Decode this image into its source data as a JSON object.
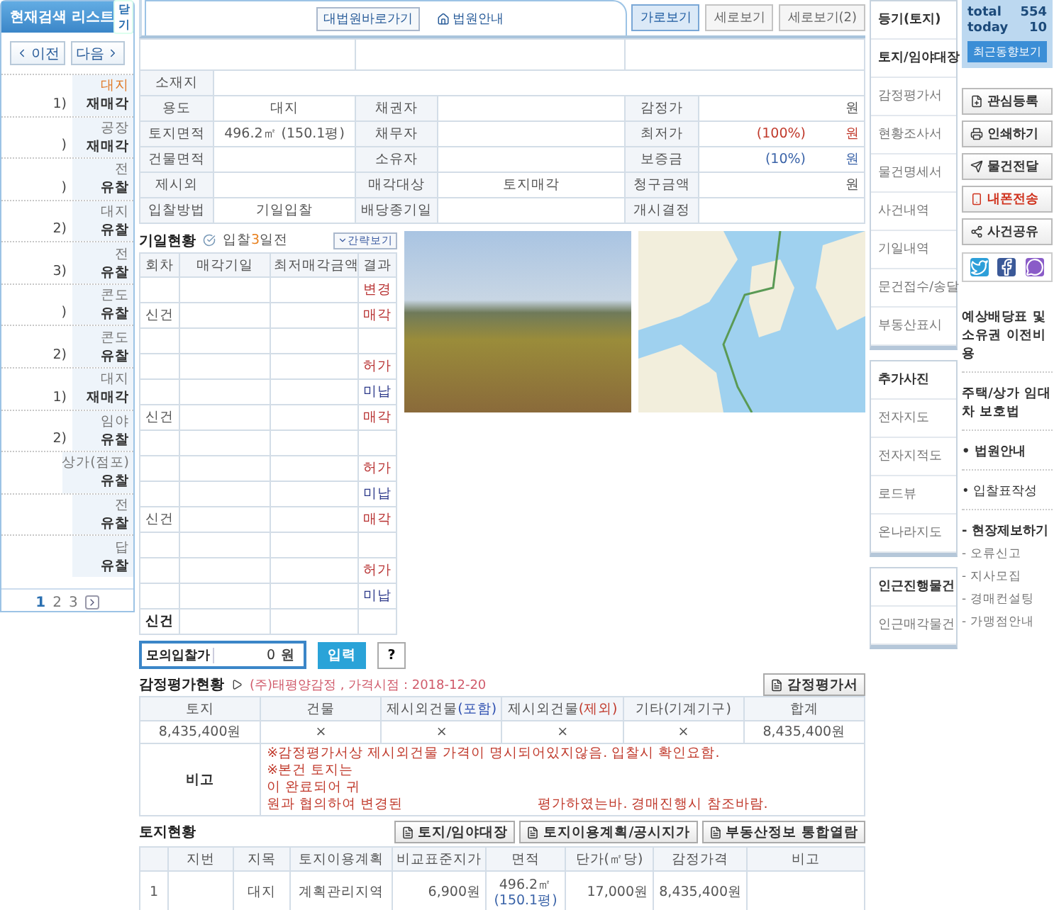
{
  "search_list": {
    "title": "현재검색 리스트",
    "close": "닫기",
    "prev": "이전",
    "next": "다음",
    "items": [
      {
        "number": "1)",
        "type": "대지",
        "status": "재매각",
        "selected": true
      },
      {
        "number": ")",
        "type": "공장",
        "status": "재매각",
        "selected": false
      },
      {
        "number": ")",
        "type": "전",
        "status": "유찰",
        "selected": false
      },
      {
        "number": "2)",
        "type": "대지",
        "status": "유찰",
        "selected": false
      },
      {
        "number": "3)",
        "type": "전",
        "status": "유찰",
        "selected": false
      },
      {
        "number": ")",
        "type": "콘도",
        "status": "유찰",
        "selected": false
      },
      {
        "number": "2)",
        "type": "콘도",
        "status": "유찰",
        "selected": false
      },
      {
        "number": "1)",
        "type": "대지",
        "status": "재매각",
        "selected": false
      },
      {
        "number": "2)",
        "type": "임야",
        "status": "유찰",
        "selected": false
      },
      {
        "type": "상가(점포)",
        "status": "유찰",
        "selected": false
      },
      {
        "type": "전",
        "status": "유찰",
        "selected": false
      },
      {
        "type": "답",
        "status": "유찰",
        "selected": false
      }
    ],
    "pages": [
      {
        "label": "1",
        "selected": true
      },
      {
        "label": "2",
        "selected": false
      },
      {
        "label": "3",
        "selected": false
      }
    ]
  },
  "top_links": [
    {
      "label": "대법원바로가기",
      "kind": "plain"
    },
    {
      "label": "법원안내",
      "kind": "home"
    }
  ],
  "view_buttons": [
    {
      "label": "가로보기",
      "selected": true
    },
    {
      "label": "세로보기",
      "selected": false
    },
    {
      "label": "세로보기(2)",
      "selected": false
    }
  ],
  "info_table": {
    "address_label": "소재지",
    "rows": [
      {
        "label1": "용도",
        "value1": "대지",
        "label2": "채권자",
        "label3": "감정가",
        "unit": "원",
        "color": "#555555"
      },
      {
        "label1": "토지면적",
        "value1": "496.2㎡ (150.1평)",
        "label2": "채무자",
        "label3": "최저가",
        "percent": "(100%)",
        "unit": "원",
        "color": "#c0392b"
      },
      {
        "label1": "건물면적",
        "label2": "소유자",
        "label3": "보증금",
        "percent": "(10%)",
        "unit": "원",
        "color": "#3a63a8"
      },
      {
        "label1": "제시외",
        "label2": "매각대상",
        "value2": "토지매각",
        "label3": "청구금액",
        "unit": "원",
        "color": "#555555"
      },
      {
        "label1": "입찰방법",
        "value1": "기일입찰",
        "label2": "배당종기일",
        "label3": "개시결정"
      }
    ]
  },
  "auction_history": {
    "title": "기일현황",
    "notice_before": "입찰",
    "notice_highlight": "3",
    "notice_after": "일전",
    "toggle": "간략보기",
    "columns": [
      "회차",
      "매각기일",
      "최저매각금액",
      "결과"
    ],
    "rows": [
      {
        "kind": "result",
        "result": "변경",
        "color": "#b83232"
      },
      {
        "kind": "result",
        "round": "신건",
        "result": "매각",
        "color": "#b83232"
      },
      {
        "kind": "blank"
      },
      {
        "kind": "result",
        "result": "허가",
        "color": "#b83232"
      },
      {
        "kind": "result",
        "result": "미납",
        "color": "#2d3a8a"
      },
      {
        "kind": "result",
        "round": "신건",
        "result": "매각",
        "color": "#b83232"
      },
      {
        "kind": "blank"
      },
      {
        "kind": "result",
        "result": "허가",
        "color": "#b83232"
      },
      {
        "kind": "result",
        "result": "미납",
        "color": "#2d3a8a"
      },
      {
        "kind": "result",
        "round": "신건",
        "result": "매각",
        "color": "#b83232"
      },
      {
        "kind": "blank"
      },
      {
        "kind": "result",
        "result": "허가",
        "color": "#b83232"
      },
      {
        "kind": "result",
        "result": "미납",
        "color": "#2d3a8a"
      },
      {
        "kind": "current",
        "round": "신건"
      }
    ]
  },
  "mock_bid": {
    "label": "모의입찰가",
    "value": "0",
    "unit": "원",
    "submit": "입력",
    "help": "?"
  },
  "appraisal": {
    "title": "감정평가현황",
    "source": "(주)태평양감정 , 가격시점 : 2018-12-20",
    "doc_button": "감정평가서",
    "columns": [
      {
        "label": "토지"
      },
      {
        "label": "건물"
      },
      {
        "label": "제시외건물",
        "note": "(포함)",
        "color": "#2d4fb0"
      },
      {
        "label": "제시외건물",
        "note": "(제외)",
        "color": "#c0392b"
      },
      {
        "label": "기타(기계기구)"
      },
      {
        "label": "합계"
      }
    ],
    "values": [
      "8,435,400원",
      "×",
      "×",
      "×",
      "×",
      "8,435,400원"
    ],
    "remark_label": "비고",
    "remarks": [
      [
        "※감정평가서상 제시외건물 가격이 명시되어있지않음. 입찰시 확인요함."
      ],
      [
        "※본건 토지는"
      ],
      [
        "이 완료되어 귀"
      ],
      [
        "원과 협의하여 변경된",
        "평가하였는바. 경매진행시 참조바람."
      ]
    ]
  },
  "land": {
    "title": "토지현황",
    "buttons": [
      "토지/임야대장",
      "토지이용계획/공시지가",
      "부동산정보 통합열람"
    ],
    "columns": [
      "지번",
      "지목",
      "토지이용계획",
      "비교표준지가",
      "면적",
      "단가(㎡당)",
      "감정가격",
      "비고"
    ],
    "rows": [
      {
        "no": "1",
        "category": "대지",
        "plan": "계획관리지역",
        "std_price": "6,900원",
        "area": "496.2㎡",
        "area_pyeong": "(150.1평)",
        "unit_price": "17,000원",
        "appraisal": "8,435,400원"
      }
    ]
  },
  "nav_groups": [
    {
      "items": [
        {
          "label": "등기(토지)",
          "bold": true
        },
        {
          "label": "토지/임야대장",
          "bold": true
        },
        {
          "label": "감정평가서",
          "bold": false
        },
        {
          "label": "현황조사서",
          "bold": false
        },
        {
          "label": "물건명세서",
          "bold": false
        },
        {
          "label": "사건내역",
          "bold": false
        },
        {
          "label": "기일내역",
          "bold": false
        },
        {
          "label": "문건접수/송달",
          "bold": false
        },
        {
          "label": "부동산표시",
          "bold": false
        }
      ]
    },
    {
      "items": [
        {
          "label": "추가사진",
          "bold": true
        },
        {
          "label": "전자지도",
          "bold": false
        },
        {
          "label": "전자지적도",
          "bold": false
        },
        {
          "label": "로드뷰",
          "bold": false
        },
        {
          "label": "온나라지도",
          "bold": false
        }
      ]
    },
    {
      "items": [
        {
          "label": "인근진행물건",
          "bold": true
        },
        {
          "label": "인근매각물건",
          "bold": false
        }
      ]
    }
  ],
  "stats": [
    {
      "label": "total",
      "value": "554"
    },
    {
      "label": "today",
      "value": "10"
    }
  ],
  "recent_button": "최근동향보기",
  "actions": [
    {
      "label": "관심등록",
      "kind": "bookmark",
      "alert": false
    },
    {
      "label": "인쇄하기",
      "kind": "print",
      "alert": false
    },
    {
      "label": "물건전달",
      "kind": "send",
      "alert": false
    },
    {
      "label": "내폰전송",
      "kind": "phone",
      "alert": true
    },
    {
      "label": "사건공유",
      "kind": "share",
      "alert": false
    }
  ],
  "social": [
    {
      "kind": "twitter"
    },
    {
      "kind": "facebook"
    },
    {
      "kind": "chat"
    }
  ],
  "side_links": [
    {
      "text": "예상배당표 및 소유권 이전비용",
      "kind": "heading"
    },
    {
      "text": "주택/상가 임대차 보호법",
      "kind": "heading"
    },
    {
      "text": "• 법원안내",
      "kind": "bold"
    },
    {
      "text": "• 입찰표작성",
      "kind": "plain"
    }
  ],
  "report": {
    "title": "- 현장제보하기",
    "items": [
      "- 오류신고",
      "- 지사모집",
      "- 경매컨설팅",
      "- 가맹점안내"
    ]
  }
}
